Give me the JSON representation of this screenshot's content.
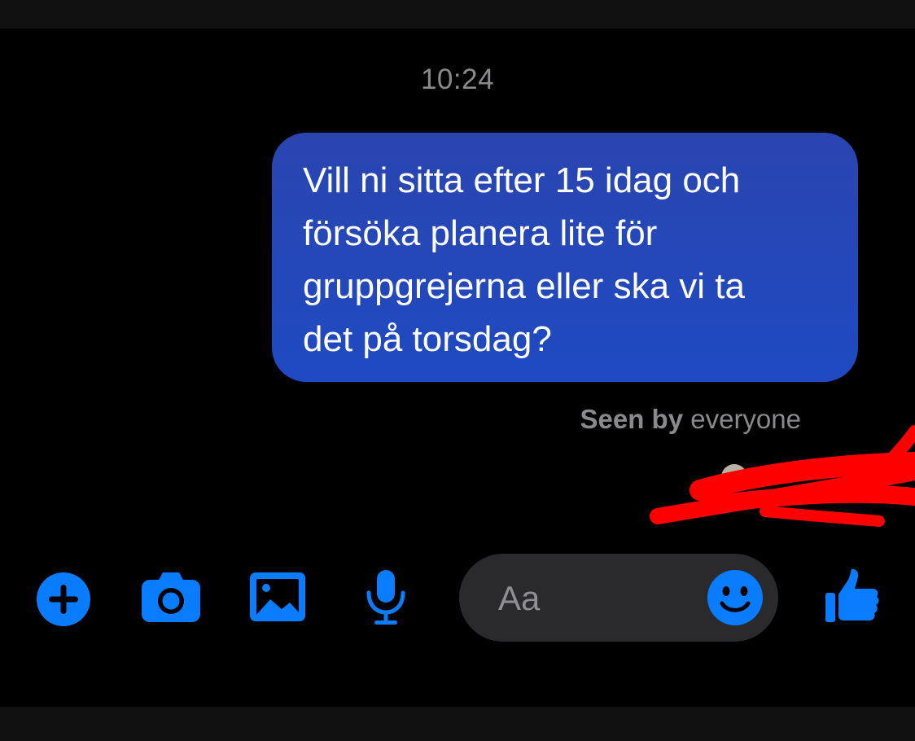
{
  "conversation": {
    "timestamp": "10:24",
    "message": {
      "lines": [
        "Vill ni sitta efter 15 idag och",
        "försöka planera lite för",
        "gruppgrejerna eller ska vi ta",
        "det på torsdag?"
      ]
    },
    "seen": {
      "prefix": "Seen by",
      "who": "everyone"
    }
  },
  "composer": {
    "placeholder": "Aa"
  },
  "icons": {
    "add": "plus-circle-icon",
    "camera": "camera-icon",
    "gallery": "photo-icon",
    "voice": "microphone-icon",
    "emoji": "smiley-icon",
    "like": "thumbs-up-icon"
  },
  "colors": {
    "accent": "#0a7cff",
    "bubble": "#2445b8",
    "redaction": "#ff0000",
    "composer_bg": "#2a2a2c",
    "meta_text": "#8a8a8d"
  }
}
